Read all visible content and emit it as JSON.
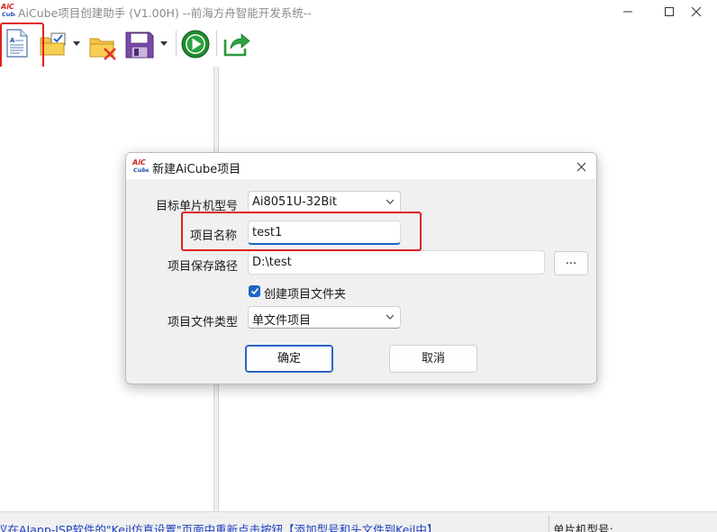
{
  "window": {
    "title": "AiCube项目创建助手 (V1.00H) --前海方舟智能开发系统--",
    "logo_text": "AiC Cube"
  },
  "toolbar": {
    "icons": [
      "new-project-icon",
      "open-project-icon",
      "close-project-icon",
      "save-project-icon",
      "run-icon",
      "export-icon"
    ]
  },
  "dialog": {
    "title": "新建AiCube项目",
    "mcu_label": "目标单片机型号",
    "mcu_value": "Ai8051U-32Bit",
    "name_label": "项目名称",
    "name_value": "test1",
    "path_label": "项目保存路径",
    "path_value": "D:\\test",
    "browse_label": "...",
    "create_folder_label": "创建项目文件夹",
    "create_folder_checked": true,
    "type_label": "项目文件类型",
    "type_value": "单文件项目",
    "ok_label": "确定",
    "cancel_label": "取消"
  },
  "status": {
    "message": "议在AIapp-ISP软件的\"Keil仿真设置\"页面中重新点击按钮【添加型号和头文件到Keil中】",
    "mcu_label": "单片机型号:"
  },
  "colors": {
    "accent": "#1e63c6",
    "highlight": "#e02020",
    "status_text": "#1d3fbf"
  }
}
